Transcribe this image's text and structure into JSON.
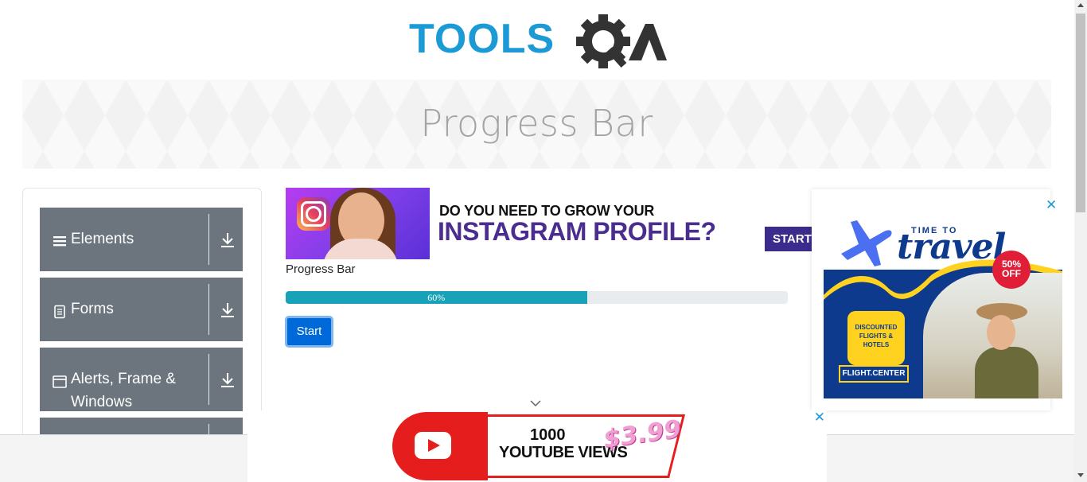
{
  "logo": {
    "text_tools": "TOOLS",
    "text_qa": "QA"
  },
  "banner": {
    "title": "Progress Bar"
  },
  "sidebar": {
    "groups": [
      {
        "label": "Elements",
        "icon": "hamburger-icon"
      },
      {
        "label": "Forms",
        "icon": "document-icon"
      },
      {
        "label": "Alerts, Frame & Windows",
        "icon": "window-icon"
      }
    ]
  },
  "ad_top": {
    "line1": "DO YOU NEED TO GROW YOUR",
    "line2": "INSTAGRAM PROFILE?",
    "button": "START"
  },
  "progress": {
    "title": "Progress Bar",
    "value_percent": 60,
    "label": "60%",
    "button": "Start",
    "bar_color": "#17a2b8"
  },
  "ad_right": {
    "time_to": "TIME TO",
    "travel": "travel",
    "discount": "50% OFF",
    "deal": "DISCOUNTED FLIGHTS & HOTELS",
    "brand": "FLIGHT.CENTER",
    "close": "✕"
  },
  "ad_bottom": {
    "line1": "1000",
    "line2": "YOUTUBE VIEWS",
    "price": "$3.99",
    "close": "✕"
  },
  "colors": {
    "brand_blue": "#1c9ad6",
    "sidebar_bg": "#6c757d",
    "primary": "#0069d9"
  }
}
